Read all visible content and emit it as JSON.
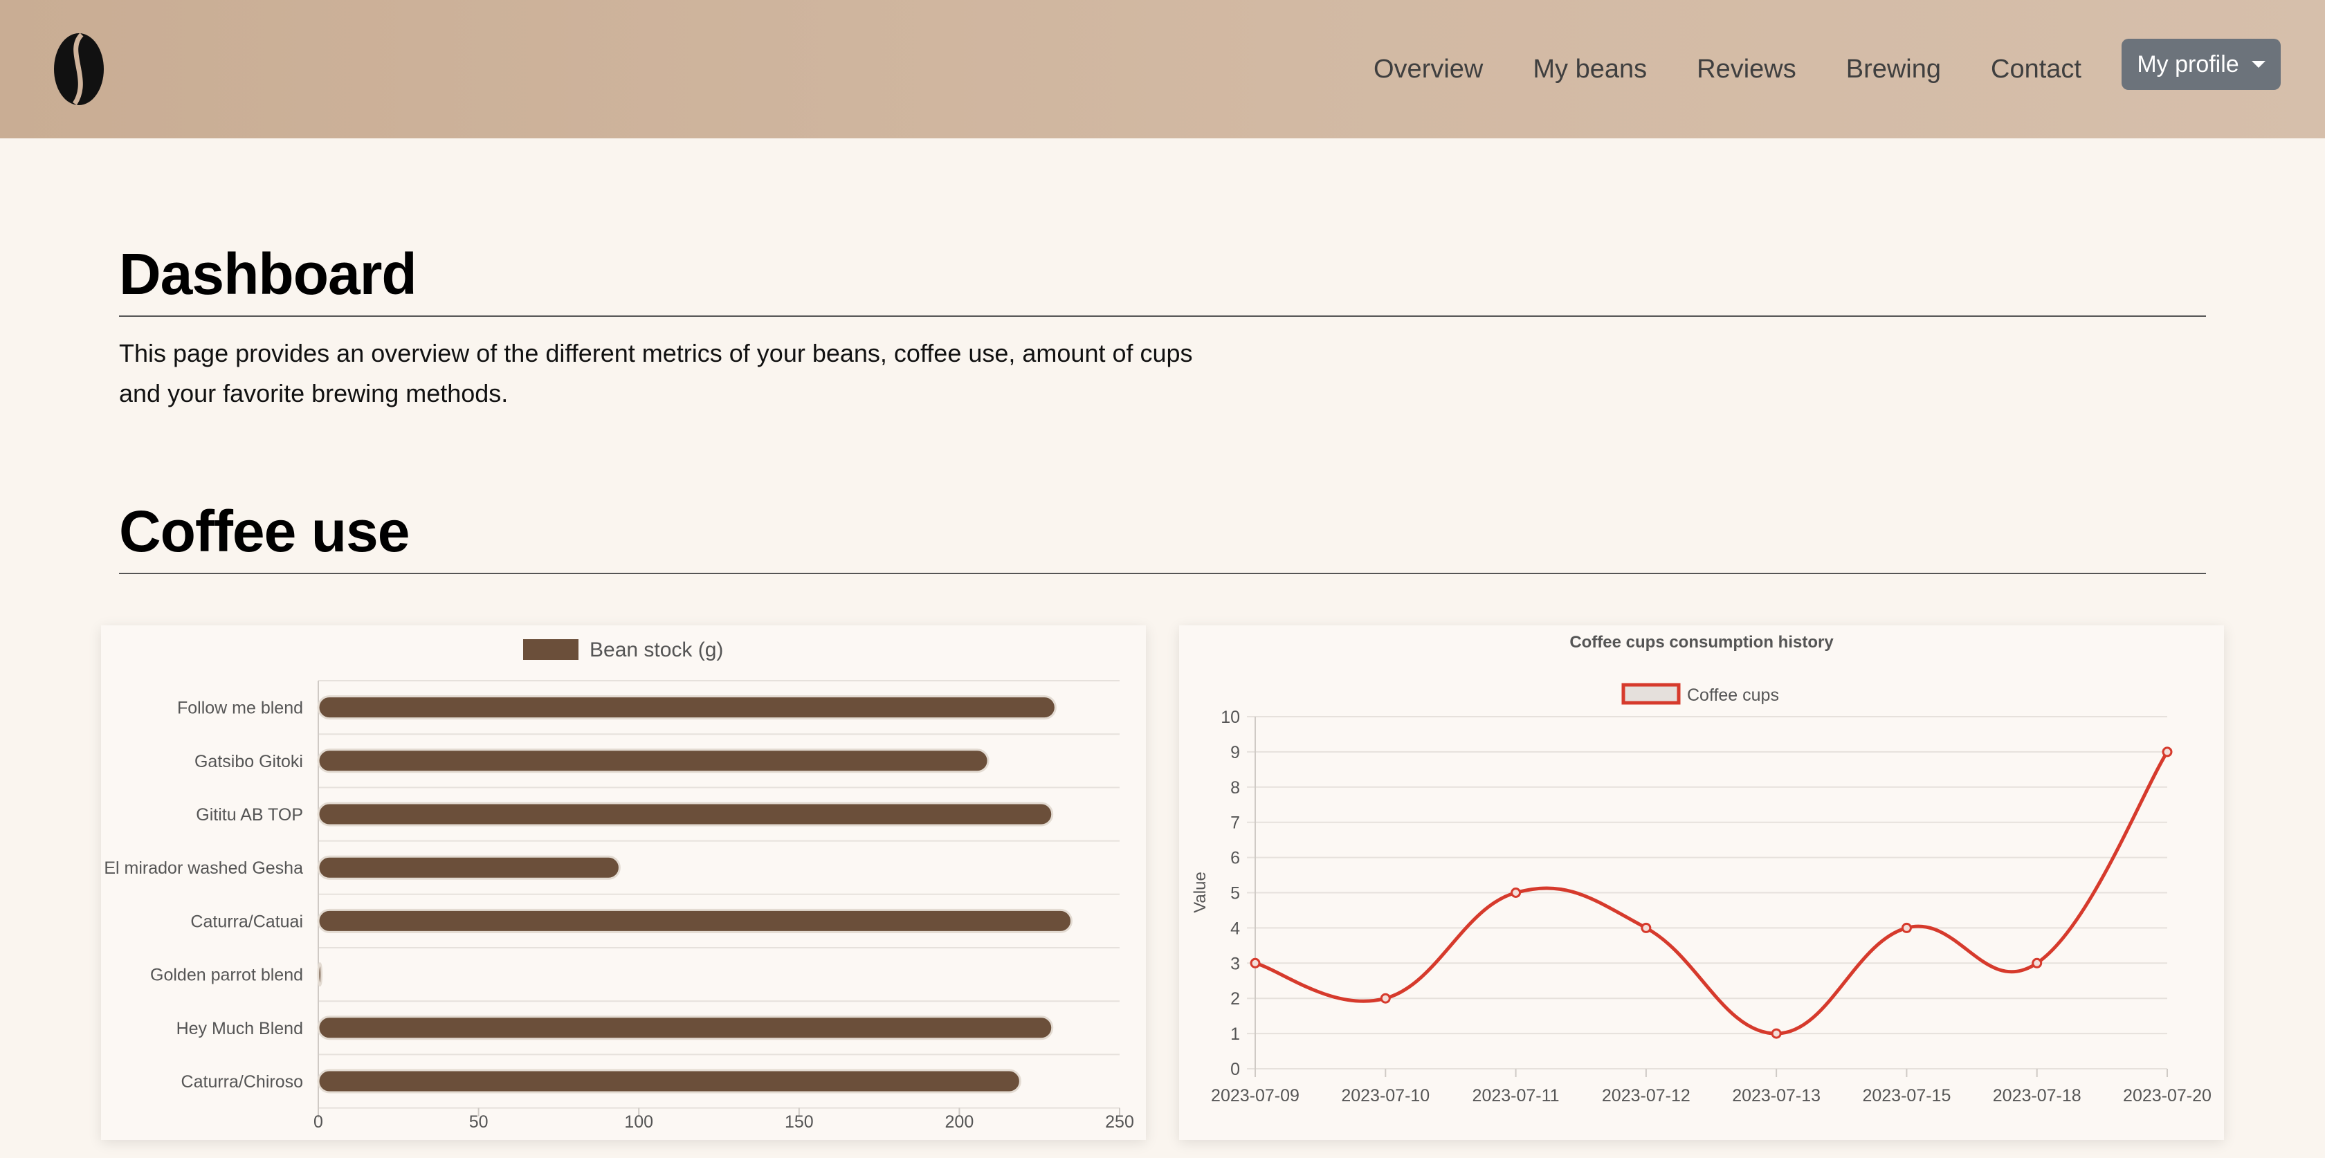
{
  "navbar": {
    "logo": "coffee-bean-logo",
    "links": [
      "Overview",
      "My beans",
      "Reviews",
      "Brewing",
      "Contact"
    ],
    "profile_label": "My profile"
  },
  "page": {
    "title": "Dashboard",
    "intro_line1": "This page provides an overview of the different metrics of your beans, coffee use, amount of cups",
    "intro_line2": "and your favorite brewing methods.",
    "section_title": "Coffee use"
  },
  "colors": {
    "bar_fill": "#6b4f3a",
    "line_color": "#d63a2c",
    "navbar": "#d0b49c"
  },
  "chart_data": [
    {
      "type": "bar",
      "orientation": "horizontal",
      "legend": "Bean stock (g)",
      "categories": [
        "Follow me blend",
        "Gatsibo Gitoki",
        "Gititu AB TOP",
        "El mirador washed Gesha",
        "Caturra/Catuai",
        "Golden parrot blend",
        "Hey Much Blend",
        "Caturra/Chiroso"
      ],
      "values": [
        230,
        209,
        229,
        94,
        235,
        1,
        229,
        219
      ],
      "xlim": [
        0,
        250
      ],
      "xticks": [
        "0",
        "50",
        "100",
        "150",
        "200",
        "250"
      ]
    },
    {
      "type": "line",
      "title": "Coffee cups consumption history",
      "legend": "Coffee cups",
      "ylabel": "Value",
      "x": [
        "2023-07-09",
        "2023-07-10",
        "2023-07-11",
        "2023-07-12",
        "2023-07-13",
        "2023-07-15",
        "2023-07-18",
        "2023-07-20"
      ],
      "values": [
        3,
        2,
        5,
        4,
        1,
        4,
        3,
        9
      ],
      "ylim": [
        0,
        10
      ],
      "yticks": [
        "0",
        "1",
        "2",
        "3",
        "4",
        "5",
        "6",
        "7",
        "8",
        "9",
        "10"
      ]
    }
  ]
}
